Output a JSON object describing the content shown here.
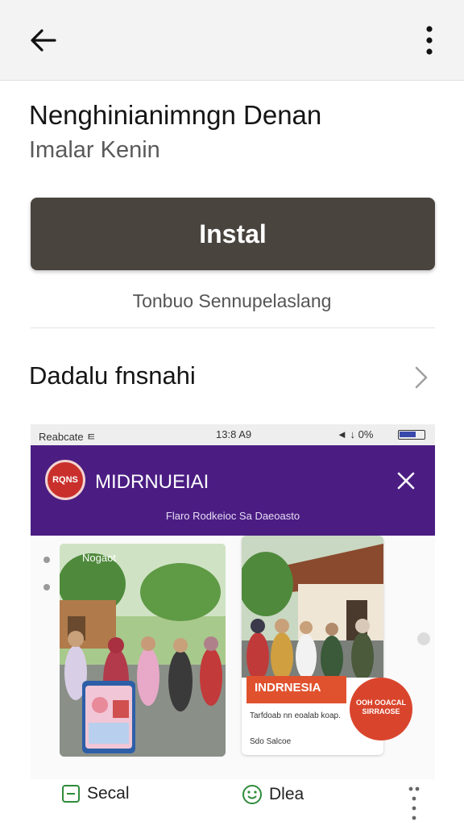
{
  "header": {
    "back_icon": "arrow-back-icon",
    "menu_icon": "more-vert-icon"
  },
  "app": {
    "title": "Nenghinianimngn Denan",
    "subtitle": "Imalar Kenin"
  },
  "install": {
    "label": "Instal",
    "note": "Tonbuo Sennupelaslang",
    "color": "#49443e"
  },
  "section": {
    "title": "Dadalu fnsnahi",
    "chevron_icon": "chevron-right-icon"
  },
  "screenshot": {
    "status": {
      "left": "Reabcate ㅌ",
      "time": "13:8 A9",
      "right": "◄ ↓ 0%",
      "battery_icon": "battery-icon"
    },
    "banner": {
      "logo": "RQNS",
      "name": "MIDRNUEIAI",
      "tagline": "Flaro Rodkeioc Sa Daeoasto",
      "close_icon": "close-icon",
      "color": "#4b1d83"
    },
    "gallery": {
      "card1_caption": "Nogaot",
      "card2_promo": "INDRNESIA",
      "card2_promo_sub": "Tarfdoab nn eoalab koap.",
      "card2_promo_sub2": "Sdo Salcoe",
      "card2_badge": "OOH OOACAL SIRRAOSE"
    }
  },
  "bottom": {
    "tab_a": {
      "label": "Secal",
      "icon": "square-minus-icon"
    },
    "tab_b": {
      "label": "Dlea",
      "icon": "smiley-icon"
    },
    "more_icon": "more-vert-icon"
  }
}
